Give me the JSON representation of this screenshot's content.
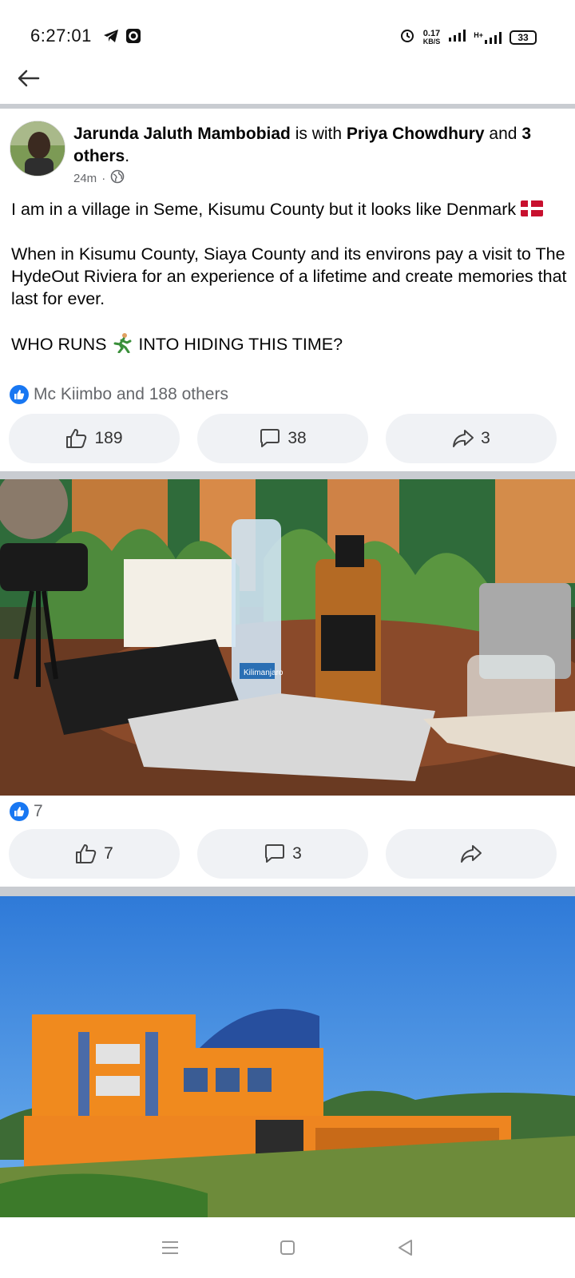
{
  "status_bar": {
    "time": "6:27:01",
    "net_speed_value": "0.17",
    "net_speed_unit": "KB/S",
    "network_label": "H+",
    "battery": "33"
  },
  "post": {
    "author": "Jarunda Jaluth Mambobiad",
    "with_text": " is with ",
    "tagged_person": "Priya Chowdhury",
    "and_text": " and ",
    "others_text": "3 others",
    "period": ".",
    "time_ago": "24m",
    "separator": "·",
    "privacy_icon": "globe-icon",
    "paragraph_1": "I am in a village in Seme, Kisumu County but it looks like Denmark",
    "paragraph_2": "When in Kisumu County, Siaya County and its environs pay a visit to The HydeOut Riviera for an experience of a lifetime and create memories that last for ever.",
    "paragraph_3_a": "WHO RUNS",
    "paragraph_3_b": "INTO HIDING THIS TIME?",
    "reactions_summary": "Mc Kiimbo and 188 others",
    "like_count": "189",
    "comment_count": "38",
    "share_count": "3"
  },
  "photo_1": {
    "reaction_count": "7",
    "like_count": "7",
    "comment_count": "3",
    "bottle_label": "Kilimanjaro"
  },
  "colors": {
    "accent": "#1877f2",
    "button_bg": "#f0f2f5",
    "divider": "#c9ccd1",
    "secondary_text": "#65676b"
  }
}
